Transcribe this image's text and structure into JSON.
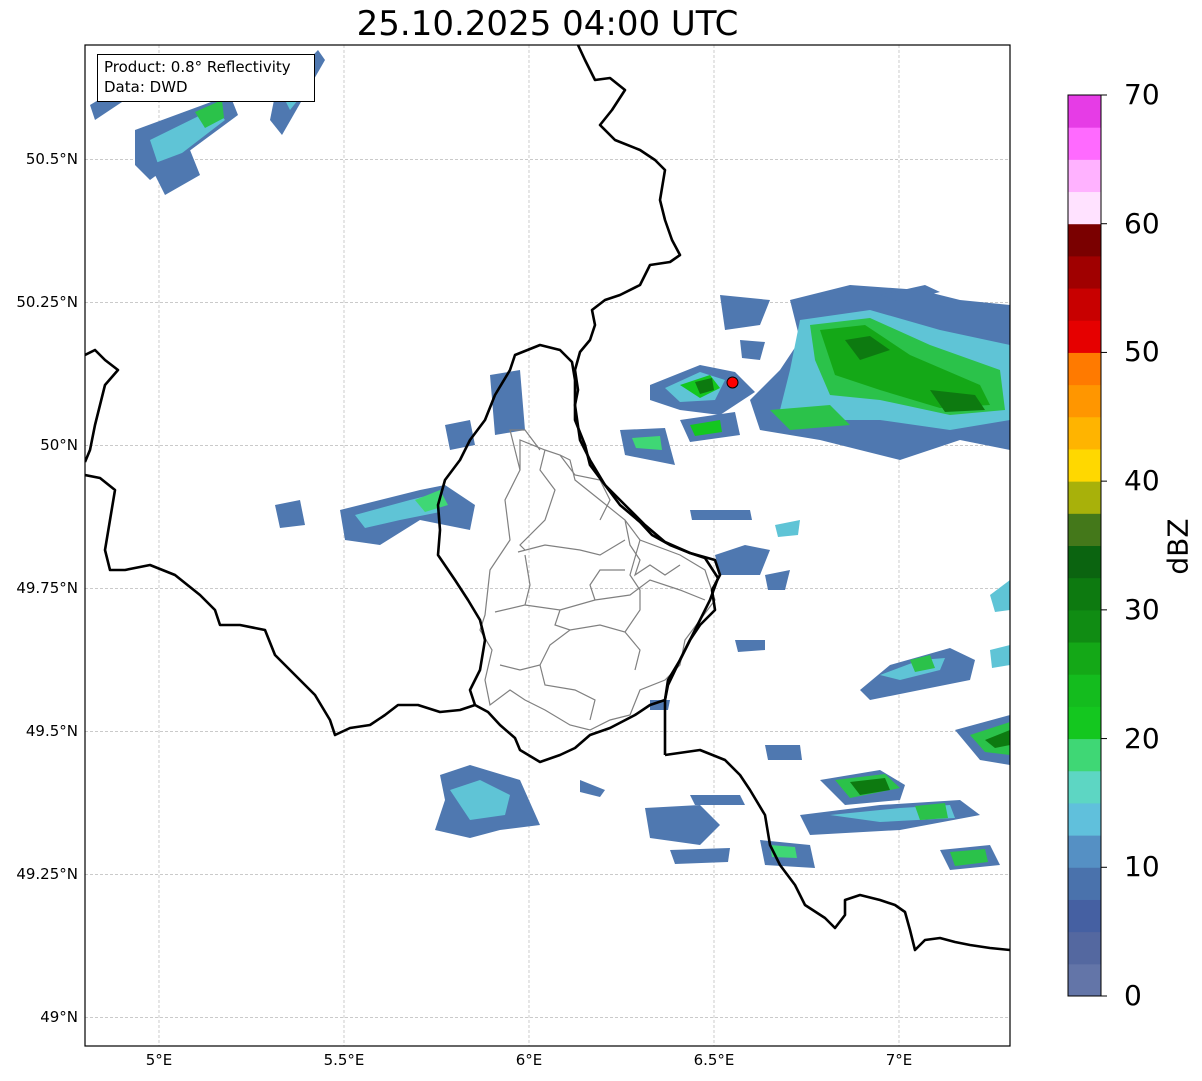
{
  "title": "25.10.2025 04:00 UTC",
  "info_box": {
    "product_line": "Product: 0.8° Reflectivity",
    "data_line": "Data: DWD"
  },
  "map_extent": {
    "lon": [
      4.8,
      7.3
    ],
    "lat": [
      48.95,
      50.7
    ]
  },
  "axes": {
    "x_ticks": [
      {
        "lon": 5.0,
        "label": "5°E"
      },
      {
        "lon": 5.5,
        "label": "5.5°E"
      },
      {
        "lon": 6.0,
        "label": "6°E"
      },
      {
        "lon": 6.5,
        "label": "6.5°E"
      },
      {
        "lon": 7.0,
        "label": "7°E"
      }
    ],
    "y_ticks": [
      {
        "lat": 50.5,
        "label": "50.5°N"
      },
      {
        "lat": 50.25,
        "label": "50.25°N"
      },
      {
        "lat": 50.0,
        "label": "50°N"
      },
      {
        "lat": 49.75,
        "label": "49.75°N"
      },
      {
        "lat": 49.5,
        "label": "49.5°N"
      },
      {
        "lat": 49.25,
        "label": "49.25°N"
      },
      {
        "lat": 49.0,
        "label": "49°N"
      }
    ],
    "grid": true
  },
  "radar_site": {
    "lon": 6.55,
    "lat": 50.11,
    "color": "#ff0000"
  },
  "colorbar": {
    "label": "dBZ",
    "range": [
      0,
      70
    ],
    "tick_labels": [
      "0",
      "10",
      "20",
      "30",
      "40",
      "50",
      "60",
      "70"
    ],
    "colors": [
      "#6375a8",
      "#5468a0",
      "#4560a2",
      "#4a72ac",
      "#5590c4",
      "#60c0dc",
      "#5dd6c3",
      "#3fd775",
      "#14c71f",
      "#14bc1e",
      "#14a817",
      "#108c13",
      "#0d7a10",
      "#0b6410",
      "#44781a",
      "#a8b10a",
      "#ffd800",
      "#ffb400",
      "#ff9600",
      "#ff7a00",
      "#e60000",
      "#c80000",
      "#a00000",
      "#7a0000",
      "#ffe2ff",
      "#ffb2ff",
      "#ff6aff",
      "#e63ce6"
    ]
  }
}
